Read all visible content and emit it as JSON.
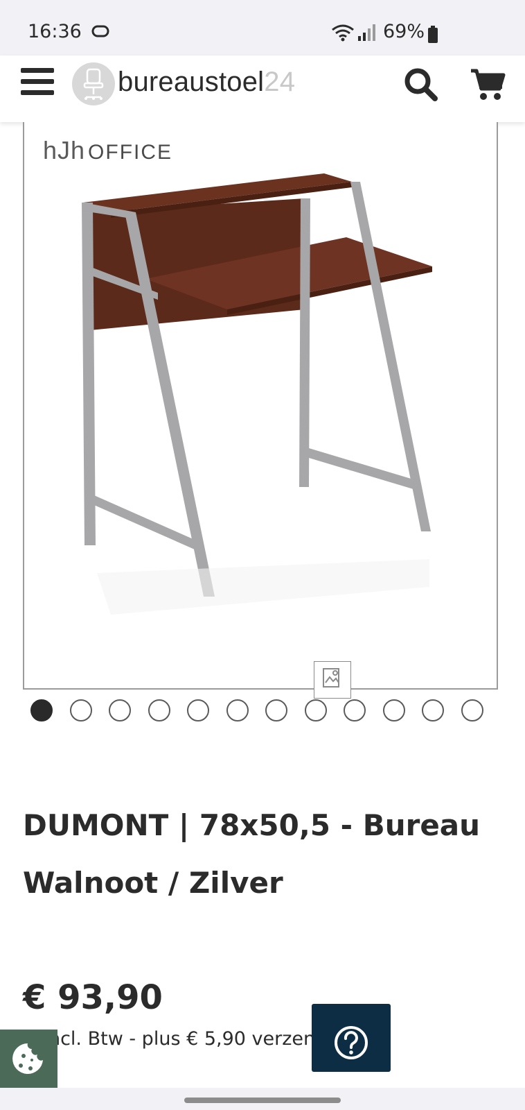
{
  "status_bar": {
    "time": "16:36",
    "battery_percent": "69%"
  },
  "header": {
    "logo_text_main": "bureaustoel",
    "logo_text_number": "24"
  },
  "gallery": {
    "brand_mark": "hJh",
    "brand_word": "OFFICE",
    "dot_count": 12,
    "active_index": 0
  },
  "product": {
    "title": "DUMONT | 78x50,5 - Bureau Walnoot / Zilver",
    "price": "€ 93,90",
    "tax_note": "Incl. Btw - plus € 5,90 verzendkosten"
  },
  "colors": {
    "cookie_button": "#4b6a58",
    "help_button": "#0d2d45",
    "wood": "#6b3220",
    "metal": "#a7a7a9"
  },
  "icons": {
    "menu": "hamburger-icon",
    "search": "search-icon",
    "cart": "cart-icon",
    "zoom": "image-zoom-icon",
    "cookie": "cookie-icon",
    "help": "question-icon"
  }
}
